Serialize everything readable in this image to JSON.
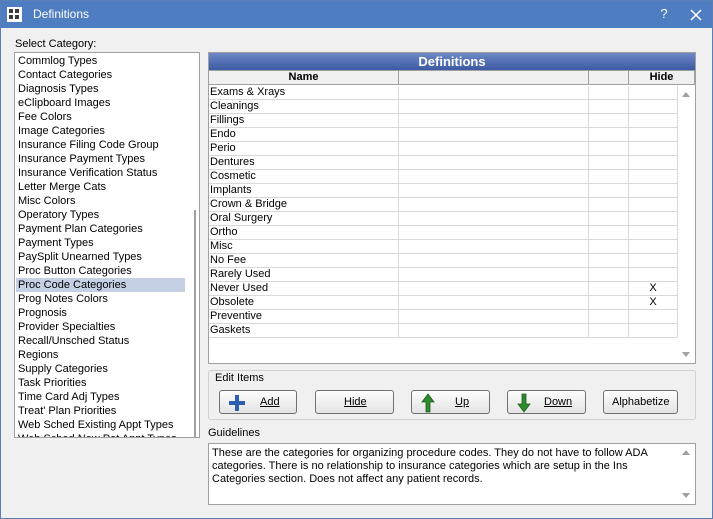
{
  "window": {
    "title": "Definitions",
    "help": "?"
  },
  "categories": {
    "label": "Select Category:",
    "items": [
      "Commlog Types",
      "Contact Categories",
      "Diagnosis Types",
      "eClipboard Images",
      "Fee Colors",
      "Image Categories",
      "Insurance Filing Code Group",
      "Insurance Payment Types",
      "Insurance Verification Status",
      "Letter Merge Cats",
      "Misc Colors",
      "Operatory Types",
      "Payment Plan Categories",
      "Payment Types",
      "PaySplit Unearned Types",
      "Proc Button Categories",
      "Proc Code Categories",
      "Prog Notes Colors",
      "Prognosis",
      "Provider Specialties",
      "Recall/Unsched Status",
      "Regions",
      "Supply Categories",
      "Task Priorities",
      "Time Card Adj Types",
      "Treat' Plan Priorities",
      "Web Sched Existing Appt Types",
      "Web Sched New Pat Appt Types"
    ],
    "selected": "Proc Code Categories"
  },
  "definitions": {
    "title": "Definitions",
    "columns": {
      "name": "Name",
      "hide": "Hide"
    },
    "rows": [
      {
        "name": "Exams & Xrays",
        "hide": ""
      },
      {
        "name": "Cleanings",
        "hide": ""
      },
      {
        "name": "Fillings",
        "hide": ""
      },
      {
        "name": "Endo",
        "hide": ""
      },
      {
        "name": "Perio",
        "hide": ""
      },
      {
        "name": "Dentures",
        "hide": ""
      },
      {
        "name": "Cosmetic",
        "hide": ""
      },
      {
        "name": "Implants",
        "hide": ""
      },
      {
        "name": "Crown & Bridge",
        "hide": ""
      },
      {
        "name": "Oral Surgery",
        "hide": ""
      },
      {
        "name": "Ortho",
        "hide": ""
      },
      {
        "name": "Misc",
        "hide": ""
      },
      {
        "name": "No Fee",
        "hide": ""
      },
      {
        "name": "Rarely Used",
        "hide": ""
      },
      {
        "name": "Never Used",
        "hide": "X"
      },
      {
        "name": "Obsolete",
        "hide": "X"
      },
      {
        "name": "Preventive",
        "hide": ""
      },
      {
        "name": "Gaskets",
        "hide": ""
      }
    ]
  },
  "edit_items": {
    "label": "Edit Items",
    "add": "Add",
    "hide": "Hide",
    "up": "Up",
    "down": "Down",
    "alphabetize": "Alphabetize"
  },
  "guidelines": {
    "label": "Guidelines",
    "text": "These are the categories for organizing procedure codes. They do not have to follow ADA categories.  There is no relationship to insurance categories which are setup in the Ins Categories section.  Does not affect any patient records."
  },
  "colors": {
    "titlebar": "#4f7dc1",
    "grid_header": "#3b5aa3",
    "selection": "#c5d0e4",
    "arrow_green": "#2e8b2e",
    "add_blue": "#2d5fb0"
  }
}
